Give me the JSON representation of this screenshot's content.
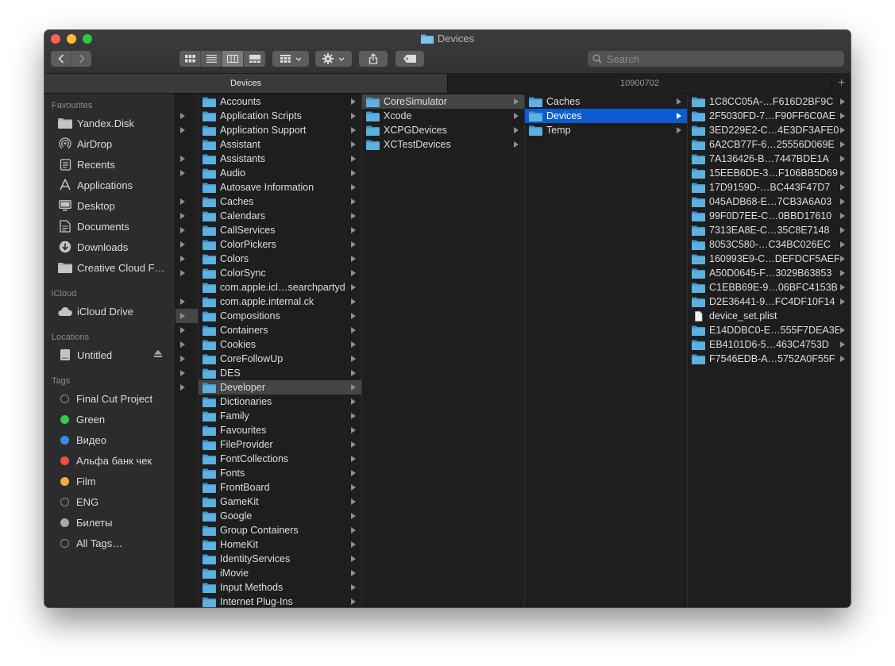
{
  "window": {
    "title": "Devices"
  },
  "toolbar": {
    "view_modes": [
      "icon-view",
      "list-view",
      "column-view",
      "gallery-view"
    ],
    "search_placeholder": "Search"
  },
  "tabs": [
    {
      "label": "Devices",
      "active": true
    },
    {
      "label": "10900702",
      "active": false
    }
  ],
  "sidebar": {
    "favourites_heading": "Favourites",
    "favourites": [
      {
        "label": "Yandex.Disk",
        "icon": "folder-icon"
      },
      {
        "label": "AirDrop",
        "icon": "airdrop-icon"
      },
      {
        "label": "Recents",
        "icon": "recents-icon"
      },
      {
        "label": "Applications",
        "icon": "applications-icon"
      },
      {
        "label": "Desktop",
        "icon": "desktop-icon"
      },
      {
        "label": "Documents",
        "icon": "documents-icon"
      },
      {
        "label": "Downloads",
        "icon": "downloads-icon"
      },
      {
        "label": "Creative Cloud F…",
        "icon": "folder-icon"
      }
    ],
    "icloud_heading": "iCloud",
    "icloud": [
      {
        "label": "iCloud Drive",
        "icon": "cloud-icon"
      }
    ],
    "locations_heading": "Locations",
    "locations": [
      {
        "label": "Untitled",
        "icon": "disk-icon"
      }
    ],
    "tags_heading": "Tags",
    "tags": [
      {
        "label": "Final Cut Project",
        "color": "#2c2c2e",
        "border": "#8a8a8d"
      },
      {
        "label": "Green",
        "color": "#2ecc4f",
        "border": "#2ecc4f"
      },
      {
        "label": "Видео",
        "color": "#2f8cf4",
        "border": "#2f8cf4"
      },
      {
        "label": "Альфа банк чек",
        "color": "#f04b4b",
        "border": "#f04b4b"
      },
      {
        "label": "Film",
        "color": "#f8a93a",
        "border": "#f8a93a"
      },
      {
        "label": "ENG",
        "color": "#2c2c2e",
        "border": "#8a8a8d"
      },
      {
        "label": "Билеты",
        "color": "#a8a8ab",
        "border": "#a8a8ab"
      },
      {
        "label": "All Tags…",
        "color": "#2c2c2e",
        "border": "#8a8a8d"
      }
    ]
  },
  "narrow_column": {
    "arrow_rows": [
      1,
      2,
      4,
      5,
      7,
      8,
      9,
      10,
      11,
      12,
      14,
      15,
      16,
      17,
      18,
      19,
      20
    ],
    "selected_row": 15
  },
  "library_column": {
    "items": [
      "Accounts",
      "Application Scripts",
      "Application Support",
      "Assistant",
      "Assistants",
      "Audio",
      "Autosave Information",
      "Caches",
      "Calendars",
      "CallServices",
      "ColorPickers",
      "Colors",
      "ColorSync",
      "com.apple.icl…searchpartyd",
      "com.apple.internal.ck",
      "Compositions",
      "Containers",
      "Cookies",
      "CoreFollowUp",
      "DES",
      "Developer",
      "Dictionaries",
      "Family",
      "Favourites",
      "FileProvider",
      "FontCollections",
      "Fonts",
      "FrontBoard",
      "GameKit",
      "Google",
      "Group Containers",
      "HomeKit",
      "IdentityServices",
      "iMovie",
      "Input Methods",
      "Internet Plug-Ins"
    ],
    "selected": "Developer"
  },
  "developer_column": {
    "items": [
      "CoreSimulator",
      "Xcode",
      "XCPGDevices",
      "XCTestDevices"
    ],
    "selected": "CoreSimulator"
  },
  "coresimulator_column": {
    "items": [
      "Caches",
      "Devices",
      "Temp"
    ],
    "selected": "Devices"
  },
  "devices_column": {
    "items": [
      {
        "name": "1C8CC05A-…F616D2BF9C",
        "type": "folder"
      },
      {
        "name": "2F5030FD-7…F90FF6C0AE",
        "type": "folder"
      },
      {
        "name": "3ED229E2-C…4E3DF3AFE0",
        "type": "folder"
      },
      {
        "name": "6A2CB77F-6…25556D069E",
        "type": "folder"
      },
      {
        "name": "7A136426-B…7447BDE1A",
        "type": "folder"
      },
      {
        "name": "15EEB6DE-3…F106BB5D69",
        "type": "folder"
      },
      {
        "name": "17D9159D-…BC443F47D7",
        "type": "folder"
      },
      {
        "name": "045ADB68-E…7CB3A6A03",
        "type": "folder"
      },
      {
        "name": "99F0D7EE-C…0BBD17610",
        "type": "folder"
      },
      {
        "name": "7313EA8E-C…35C8E7148",
        "type": "folder"
      },
      {
        "name": "8053C580-…C34BC026EC",
        "type": "folder"
      },
      {
        "name": "160993E9-C…DEFDCF5AEF",
        "type": "folder"
      },
      {
        "name": "A50D0645-F…3029B63853",
        "type": "folder"
      },
      {
        "name": "C1EBB69E-9…06BFC4153B",
        "type": "folder"
      },
      {
        "name": "D2E36441-9…FC4DF10F14",
        "type": "folder"
      },
      {
        "name": "device_set.plist",
        "type": "file"
      },
      {
        "name": "E14DDBC0-E…555F7DEA3E",
        "type": "folder"
      },
      {
        "name": "EB4101D6-5…463C4753D",
        "type": "folder"
      },
      {
        "name": "F7546EDB-A…5752A0F55F",
        "type": "folder"
      }
    ]
  }
}
